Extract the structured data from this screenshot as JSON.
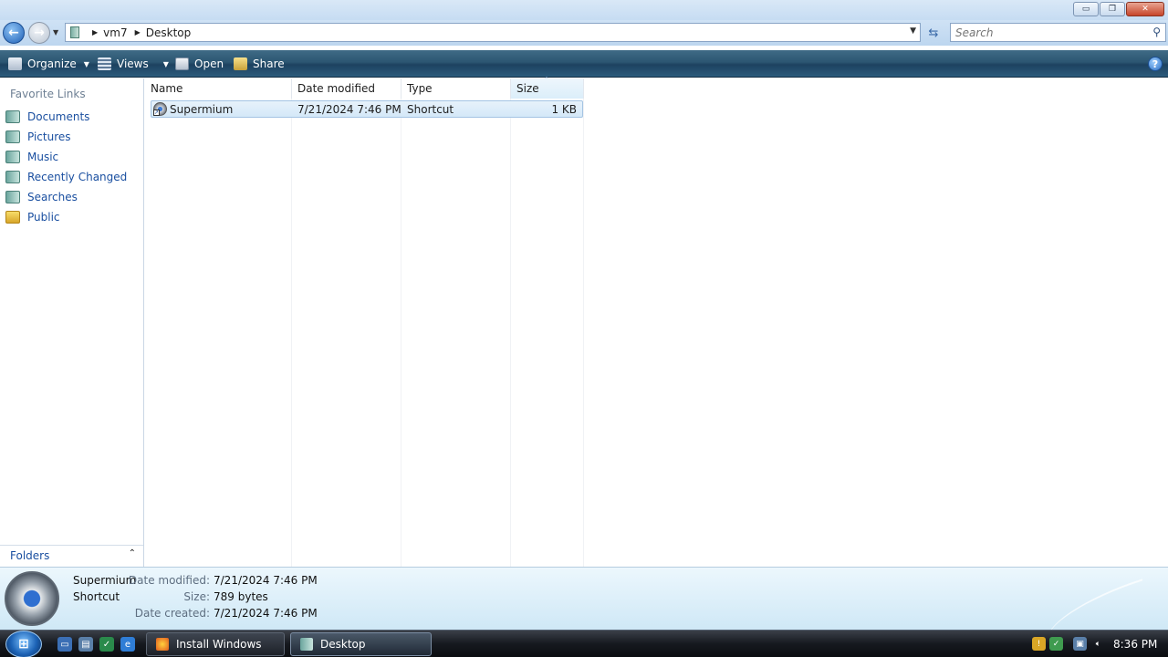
{
  "window": {
    "minimize_label": "▭",
    "maximize_label": "❐",
    "close_label": "✕"
  },
  "address": {
    "breadcrumbs": [
      "vm7",
      "Desktop"
    ]
  },
  "search": {
    "placeholder": "Search"
  },
  "toolbar": {
    "organize_label": "Organize",
    "views_label": "Views",
    "open_label": "Open",
    "share_label": "Share"
  },
  "sidebar": {
    "heading": "Favorite Links",
    "items": [
      {
        "label": "Documents",
        "icon": "documents-icon"
      },
      {
        "label": "Pictures",
        "icon": "pictures-icon"
      },
      {
        "label": "Music",
        "icon": "music-icon"
      },
      {
        "label": "Recently Changed",
        "icon": "recently-changed-icon"
      },
      {
        "label": "Searches",
        "icon": "searches-icon"
      },
      {
        "label": "Public",
        "icon": "public-folder-icon"
      }
    ],
    "folders_label": "Folders"
  },
  "filelist": {
    "columns": [
      "Name",
      "Date modified",
      "Type",
      "Size"
    ],
    "rows": [
      {
        "name": "Supermium",
        "date_modified": "7/21/2024 7:46 PM",
        "type": "Shortcut",
        "size": "1 KB"
      }
    ]
  },
  "details": {
    "name": "Supermium",
    "type": "Shortcut",
    "date_modified_label": "Date modified:",
    "date_modified": "7/21/2024 7:46 PM",
    "size_label": "Size:",
    "size": "789 bytes",
    "date_created_label": "Date created:",
    "date_created": "7/21/2024 7:46 PM"
  },
  "taskbar": {
    "tasks": [
      {
        "label": "Install Windows",
        "active": false
      },
      {
        "label": "Desktop",
        "active": true
      }
    ],
    "clock": "8:36 PM"
  },
  "colors": {
    "link_blue": "#1a4fa0",
    "cmdbar_dark": "#1d4260",
    "selection": "#d4e8f8"
  }
}
